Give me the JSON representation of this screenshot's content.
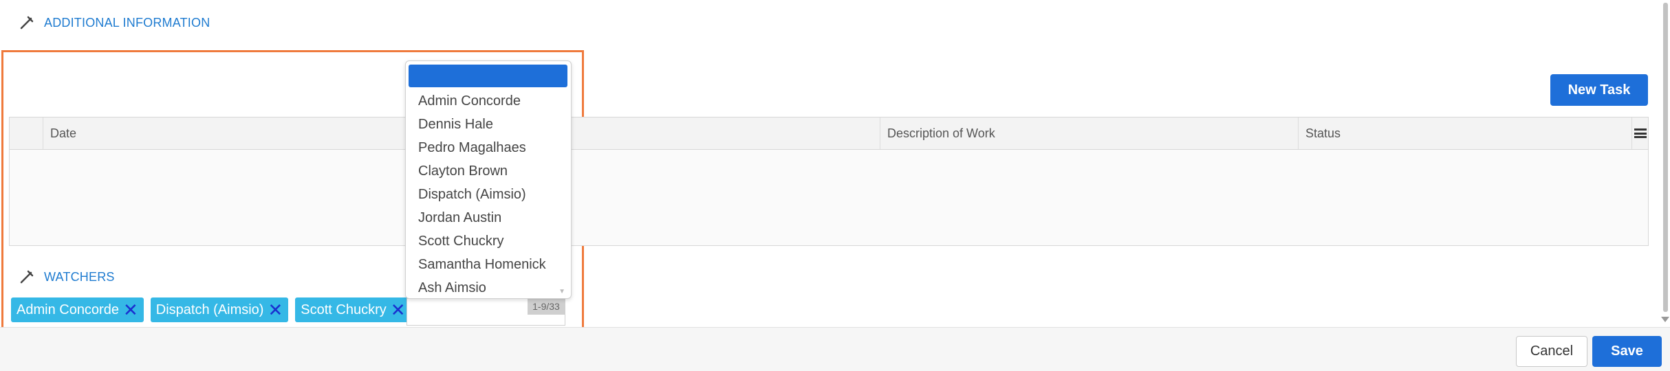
{
  "additional_info": {
    "title": "ADDITIONAL INFORMATION"
  },
  "tasks": {
    "new_task_label": "New Task",
    "columns": {
      "date": "Date",
      "description": "Description of Work",
      "status": "Status"
    }
  },
  "watchers": {
    "title": "WATCHERS",
    "selected": [
      "Admin Concorde",
      "Dispatch (Aimsio)",
      "Scott Chuckry"
    ],
    "remove_symbol": "✕",
    "input_value": "",
    "counter": "1-9/33"
  },
  "dropdown": {
    "options": [
      "Admin Concorde",
      "Dennis Hale",
      "Pedro Magalhaes",
      "Clayton Brown",
      "Dispatch (Aimsio)",
      "Jordan Austin",
      "Scott Chuckry",
      "Samantha Homenick",
      "Ash Aimsio"
    ]
  },
  "footer": {
    "cancel_label": "Cancel",
    "save_label": "Save"
  },
  "colors": {
    "accent": "#1e6fd9",
    "chip": "#35b8e6",
    "highlight": "#ef7a3c",
    "section_title": "#1e7bd0"
  }
}
